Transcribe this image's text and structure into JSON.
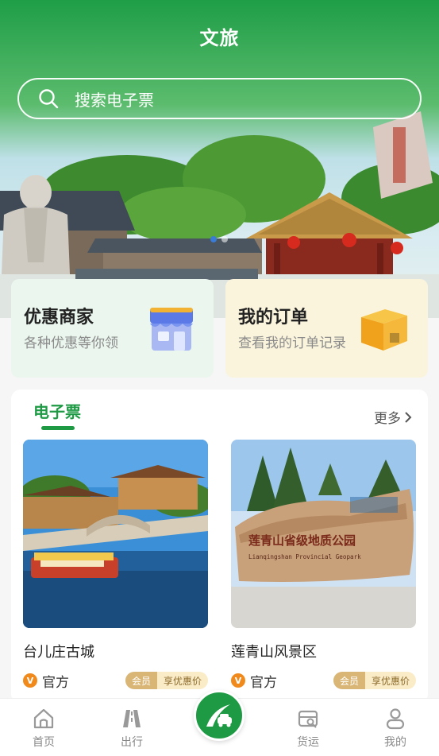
{
  "header": {
    "title": "文旅"
  },
  "search": {
    "placeholder": "搜索电子票"
  },
  "banner": {
    "dot_count": 2,
    "active_dot": 1
  },
  "quick_cards": [
    {
      "title": "优惠商家",
      "subtitle": "各种优惠等你领",
      "icon": "shop-icon"
    },
    {
      "title": "我的订单",
      "subtitle": "查看我的订单记录",
      "icon": "package-icon"
    }
  ],
  "tickets": {
    "section_title": "电子票",
    "more_label": "更多",
    "items": [
      {
        "name": "台儿庄古城",
        "official_label": "官方",
        "badge_letter": "V",
        "member_label": "会员",
        "discount_label": "享优惠价"
      },
      {
        "name": "莲青山风景区",
        "official_label": "官方",
        "badge_letter": "V",
        "member_label": "会员",
        "discount_label": "享优惠价",
        "sign_text": "莲青山省级地质公园",
        "sign_subtext": "Lianqingshan Provincial Geopark"
      }
    ]
  },
  "tabbar": {
    "items": [
      {
        "label": "首页",
        "icon": "home-icon"
      },
      {
        "label": "出行",
        "icon": "road-icon"
      },
      {
        "label": "",
        "icon": "car-road-icon"
      },
      {
        "label": "货运",
        "icon": "truck-icon"
      },
      {
        "label": "我的",
        "icon": "user-icon"
      }
    ]
  },
  "colors": {
    "brand_green": "#1f9a44",
    "active_dot": "#3a7bd5",
    "badge_orange": "#f08a1c"
  }
}
